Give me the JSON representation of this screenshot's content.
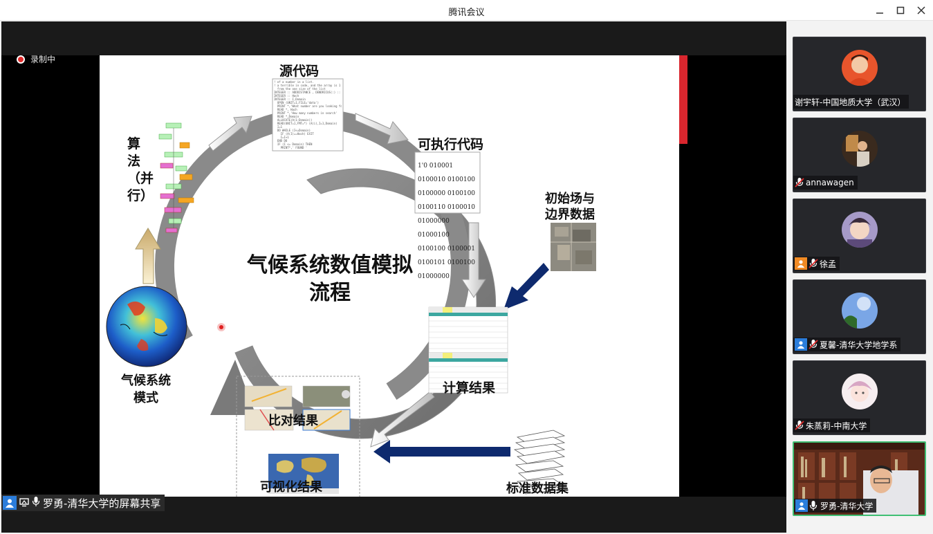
{
  "window": {
    "title": "腾讯会议"
  },
  "recording": {
    "label": "录制中"
  },
  "slide": {
    "title_line1": "气候系统数值模拟",
    "title_line2": "流程",
    "labels": {
      "source_code": "源代码",
      "executable": "可执行代码",
      "algorithm": "算法（并行）",
      "init_boundary_1": "初始场与",
      "init_boundary_2": "边界数据",
      "model_1": "气候系统",
      "model_2": "模式",
      "compute_results": "计算结果",
      "compare_results": "比对结果",
      "visual_results": "可视化结果",
      "standard_dataset": "标准数据集"
    },
    "binary_lines": [
      "1'0 010001 0100010 0100100",
      "0100000 0100100 0100110 0100010",
      "01000000 01000100 0100100 0100001",
      "0100101 0100100 01000000"
    ]
  },
  "sharer": {
    "label": "罗勇-清华大学的屏幕共享"
  },
  "participants": [
    {
      "name": "谢宇轩-中国地质大学（武汉）",
      "avatar": "avatar-portrait",
      "muted": false,
      "badge": false
    },
    {
      "name": "annawagen",
      "avatar": "avatar-photo-room",
      "muted": true,
      "badge": false
    },
    {
      "name": "徐孟",
      "avatar": "avatar-portrait-woman",
      "muted": true,
      "badge": "orange"
    },
    {
      "name": "夏馨-清华大学地学系",
      "avatar": "avatar-sky",
      "muted": true,
      "badge": "blue"
    },
    {
      "name": "朱蒸莉-中南大学",
      "avatar": "avatar-drawing",
      "muted": true,
      "badge": false
    },
    {
      "name": "罗勇-清华大学",
      "avatar": "video-feed",
      "muted": false,
      "badge": "blue"
    }
  ],
  "colors": {
    "accent_green": "#3fbf73",
    "record_red": "#e02b2b",
    "badge_blue": "#2b7ddb",
    "badge_orange": "#f08a24"
  }
}
